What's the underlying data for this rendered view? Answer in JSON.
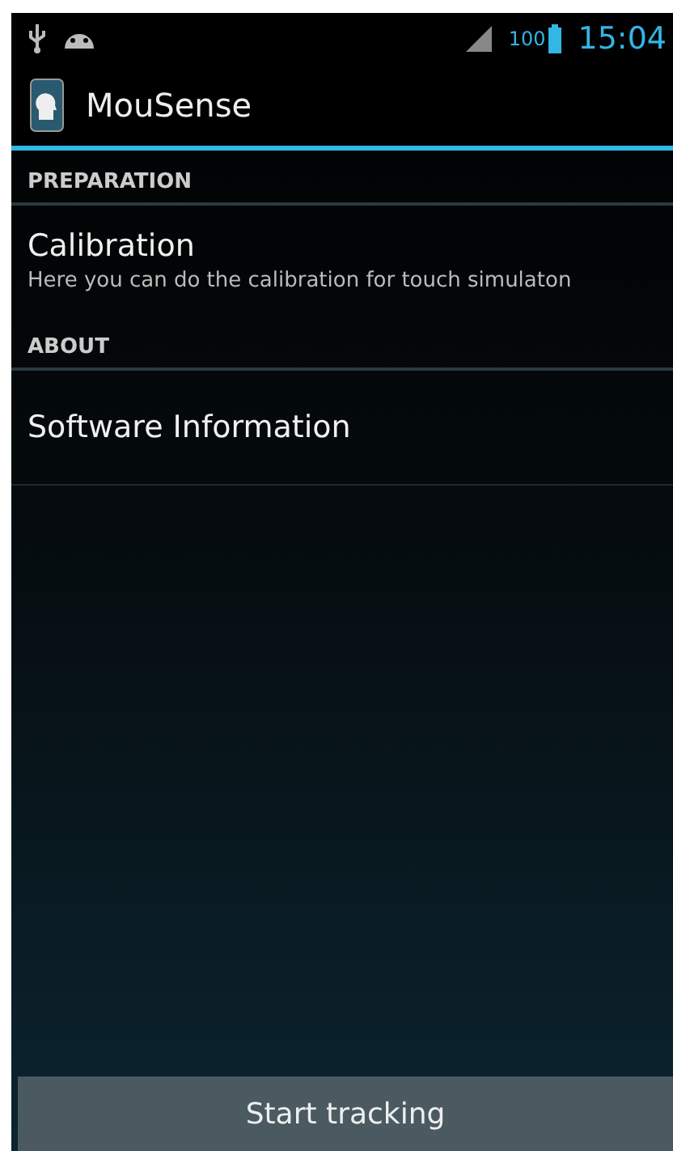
{
  "status_bar": {
    "battery_text": "100",
    "time": "15:04"
  },
  "action_bar": {
    "title": "MouSense"
  },
  "sections": [
    {
      "header": "PREPARATION",
      "items": [
        {
          "title": "Calibration",
          "summary": "Here you can do the calibration for touch simulaton"
        }
      ]
    },
    {
      "header": "ABOUT",
      "items": [
        {
          "title": "Software Information"
        }
      ]
    }
  ],
  "button": "Start tracking"
}
